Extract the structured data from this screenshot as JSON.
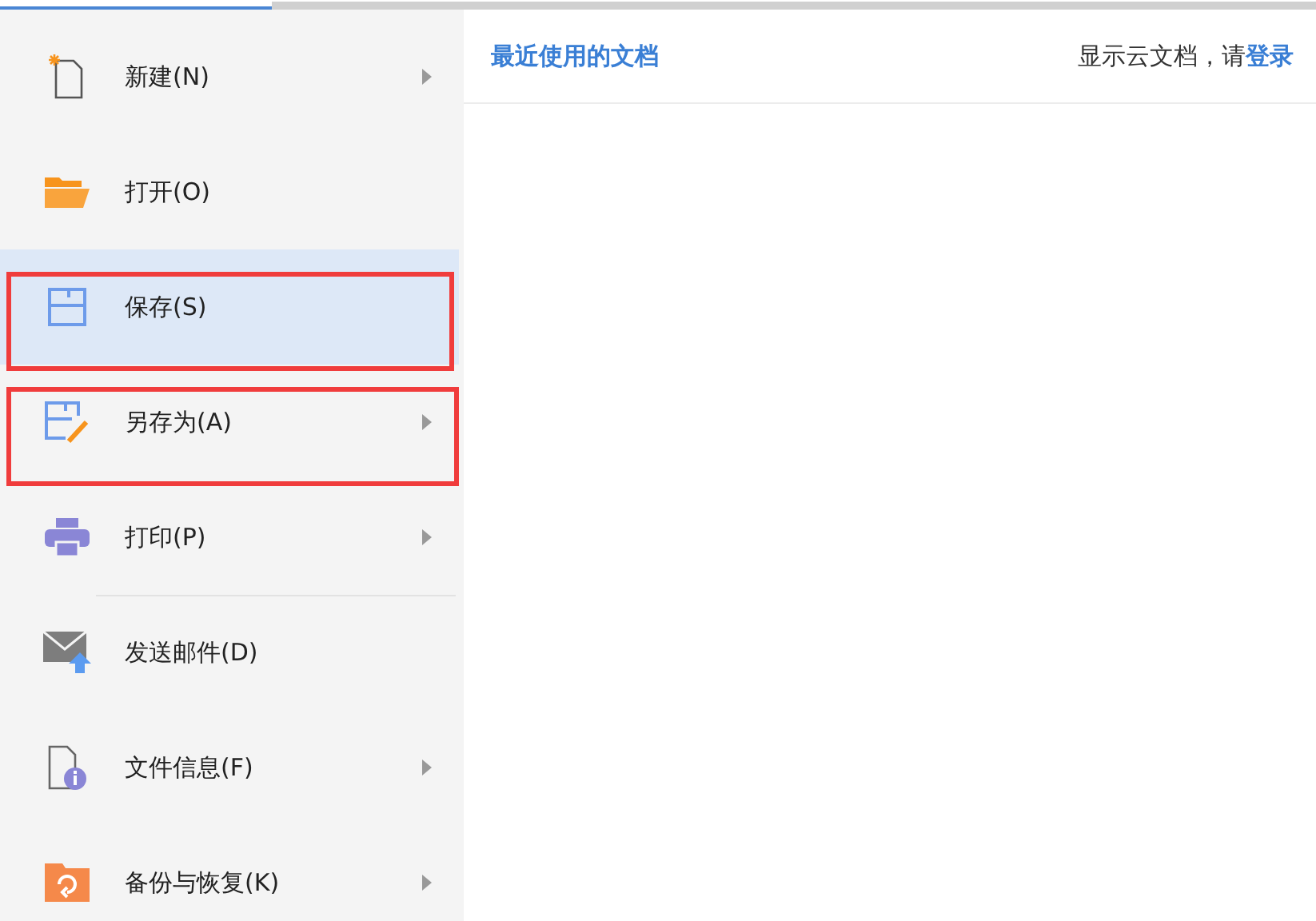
{
  "menu": {
    "items": [
      {
        "kind": "new",
        "label": "新建(N)",
        "submenu": true,
        "selected": false,
        "outlined": false,
        "divider_before": false
      },
      {
        "kind": "open",
        "label": "打开(O)",
        "submenu": false,
        "selected": false,
        "outlined": false,
        "divider_before": false
      },
      {
        "kind": "save",
        "label": "保存(S)",
        "submenu": false,
        "selected": true,
        "outlined": true,
        "divider_before": false
      },
      {
        "kind": "save-as",
        "label": "另存为(A)",
        "submenu": true,
        "selected": false,
        "outlined": true,
        "divider_before": false
      },
      {
        "kind": "print",
        "label": "打印(P)",
        "submenu": true,
        "selected": false,
        "outlined": false,
        "divider_before": false
      },
      {
        "kind": "mail",
        "label": "发送邮件(D)",
        "submenu": false,
        "selected": false,
        "outlined": false,
        "divider_before": true
      },
      {
        "kind": "info",
        "label": "文件信息(F)",
        "submenu": true,
        "selected": false,
        "outlined": false,
        "divider_before": false
      },
      {
        "kind": "backup",
        "label": "备份与恢复(K)",
        "submenu": true,
        "selected": false,
        "outlined": false,
        "divider_before": false
      }
    ]
  },
  "recent": {
    "title": "最近使用的文档",
    "cloud_hint": "显示云文档，请",
    "login_link": "登录"
  }
}
